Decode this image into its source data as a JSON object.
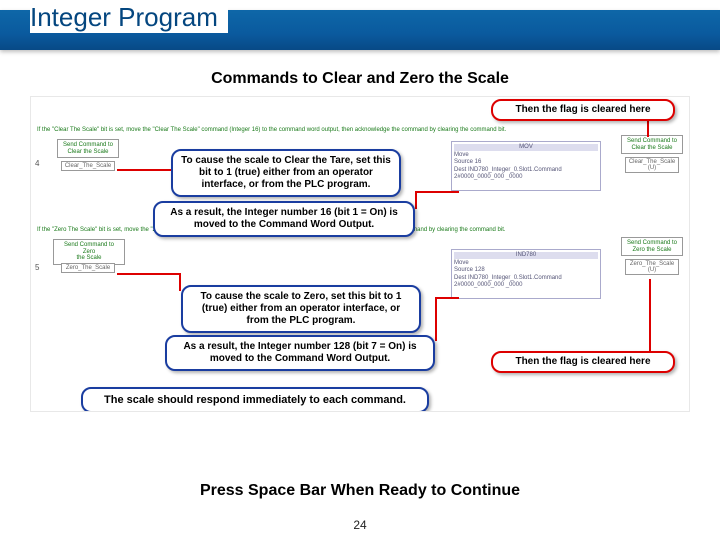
{
  "title": "Integer Program",
  "subtitle": "Commands to Clear and Zero the Scale",
  "callouts": {
    "flag_cleared_top": "Then the flag is cleared here",
    "clear_tare_cause": "To cause the scale to Clear the Tare, set this bit to 1 (true) either from an operator interface, or from the PLC program.",
    "clear_tare_result": "As a result, the Integer number 16 (bit 1 = On) is moved to the Command Word Output.",
    "zero_cause": "To cause the scale to Zero, set this bit to 1 (true) either from an operator interface, or from the PLC program.",
    "zero_result": "As a result, the Integer number 128 (bit 7 = On) is moved to the Command Word Output.",
    "flag_cleared_bottom": "Then the flag is cleared here",
    "summary": "The scale should respond immediately to each command."
  },
  "press_space": "Press Space Bar When Ready to Continue",
  "page_number": "24",
  "ladder": {
    "rung4_num": "4",
    "rung5_num": "5",
    "rung4_desc": "If the \"Clear The Scale\" bit is set, move the \"Clear The Scale\" command (Integer 16) to the command word output, then acknowledge the command by clearing the command bit.",
    "rung5_desc": "If the \"Zero The Scale\" bit is set, move the \"Zero The Scale\" command (Integer 128) to the command word output, then acknowledge the command by clearing the command bit.",
    "tag4_left": "Send Command to\nClear the Scale",
    "tag4_left_name": "Clear_The_Scale",
    "tag4_right": "Send Command to\nClear the Scale",
    "tag4_right_name": "Clear_The_Scale\n(U)",
    "mov4_title": "MOV",
    "mov4_l1": "Move",
    "mov4_l2": "Source                    16",
    "mov4_l3": "Dest   IND780_Integer_0.Slot1.Command",
    "mov4_l4": "         2#0000_0000_000 _0000",
    "tag5_left": "Send Command to Zero\nthe Scale",
    "tag5_left_name": "Zero_The_Scale",
    "tag5_right": "Send Command to\nZero the Scale",
    "tag5_right_name": "Zero_The_Scale\n(U)",
    "mov5_title": "IND780",
    "mov5_l1": "Move",
    "mov5_l2": "Source                    128",
    "mov5_l3": "Dest   IND780_Integer_0.Slot1.Command",
    "mov5_l4": "         2#0000_0000_000 _0000"
  }
}
